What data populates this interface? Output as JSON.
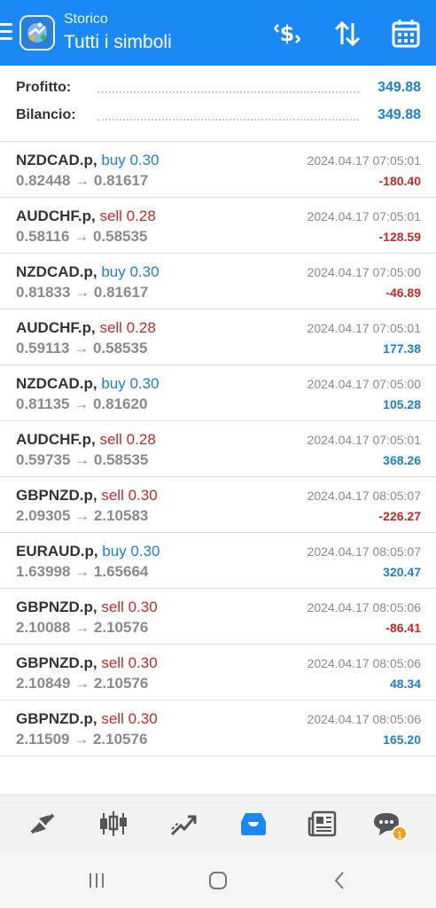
{
  "header": {
    "subtitle": "Storico",
    "title": "Tutti i simboli",
    "icons": [
      "menu-icon",
      "app-logo",
      "deposit-dollar-icon",
      "sort-icon",
      "calendar-icon"
    ]
  },
  "summary": {
    "profit_label": "Profitto:",
    "profit_value": "349.88",
    "balance_label": "Bilancio:",
    "balance_value": "349.88"
  },
  "trades": [
    {
      "symbol": "NZDCAD.p,",
      "side": "buy 0.30",
      "prices": "0.82448 → 0.81617",
      "time": "2024.04.17 07:05:01",
      "profit": "-180.40"
    },
    {
      "symbol": "AUDCHF.p,",
      "side": "sell 0.28",
      "prices": "0.58116 → 0.58535",
      "time": "2024.04.17 07:05:01",
      "profit": "-128.59"
    },
    {
      "symbol": "NZDCAD.p,",
      "side": "buy 0.30",
      "prices": "0.81833 → 0.81617",
      "time": "2024.04.17 07:05:00",
      "profit": "-46.89"
    },
    {
      "symbol": "AUDCHF.p,",
      "side": "sell 0.28",
      "prices": "0.59113 → 0.58535",
      "time": "2024.04.17 07:05:01",
      "profit": "177.38"
    },
    {
      "symbol": "NZDCAD.p,",
      "side": "buy 0.30",
      "prices": "0.81135 → 0.81620",
      "time": "2024.04.17 07:05:00",
      "profit": "105.28"
    },
    {
      "symbol": "AUDCHF.p,",
      "side": "sell 0.28",
      "prices": "0.59735 → 0.58535",
      "time": "2024.04.17 07:05:01",
      "profit": "368.26"
    },
    {
      "symbol": "GBPNZD.p,",
      "side": "sell 0.30",
      "prices": "2.09305 → 2.10583",
      "time": "2024.04.17 08:05:07",
      "profit": "-226.27"
    },
    {
      "symbol": "EURAUD.p,",
      "side": "buy 0.30",
      "prices": "1.63998 → 1.65664",
      "time": "2024.04.17 08:05:07",
      "profit": "320.47"
    },
    {
      "symbol": "GBPNZD.p,",
      "side": "sell 0.30",
      "prices": "2.10088 → 2.10576",
      "time": "2024.04.17 08:05:06",
      "profit": "-86.41"
    },
    {
      "symbol": "GBPNZD.p,",
      "side": "sell 0.30",
      "prices": "2.10849 → 2.10576",
      "time": "2024.04.17 08:05:06",
      "profit": "48.34"
    },
    {
      "symbol": "GBPNZD.p,",
      "side": "sell 0.30",
      "prices": "2.11509 → 2.10576",
      "time": "2024.04.17 08:05:06",
      "profit": "165.20"
    }
  ],
  "bottom_nav": {
    "items": [
      "quotes-icon",
      "chart-candles-icon",
      "trade-icon",
      "history-icon",
      "news-icon",
      "chat-icon"
    ],
    "active": "history-icon",
    "chat_badge": "1"
  },
  "system_nav": {
    "items": [
      "recent-apps-icon",
      "home-icon",
      "back-icon"
    ]
  },
  "colors": {
    "header_bg": "#1a88f5",
    "buy": "#1c7fcf",
    "sell": "#c62828",
    "profit_positive": "#1c7fcf",
    "profit_negative": "#c62828",
    "badge": "#f2a020"
  }
}
